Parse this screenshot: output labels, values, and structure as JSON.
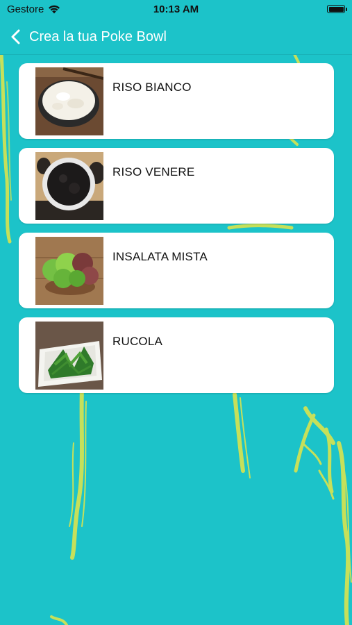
{
  "status_bar": {
    "carrier": "Gestore",
    "time": "10:13 AM"
  },
  "nav": {
    "back_title": "Crea la tua Poke Bowl"
  },
  "items": [
    {
      "label": "RISO BIANCO",
      "image": "white-rice-bowl"
    },
    {
      "label": "RISO VENERE",
      "image": "black-rice-bowl"
    },
    {
      "label": "INSALATA MISTA",
      "image": "mixed-salad"
    },
    {
      "label": "RUCOLA",
      "image": "arugula-dish"
    }
  ],
  "colors": {
    "background": "#1cc3c9",
    "decoration": "#c6e05a",
    "card": "#ffffff",
    "nav_text": "#ffffff"
  }
}
